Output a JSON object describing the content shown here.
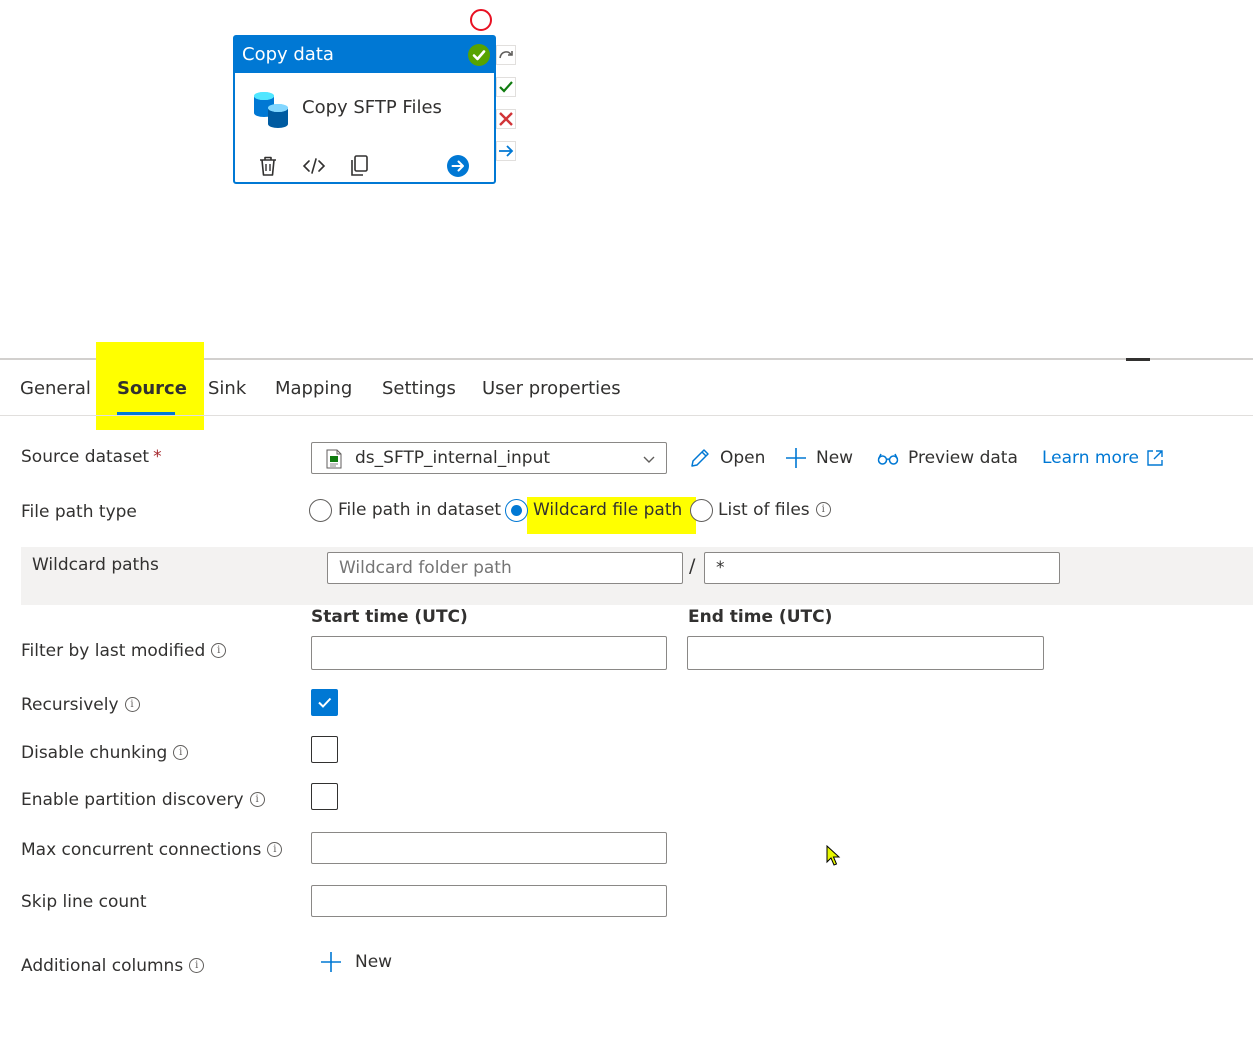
{
  "activity": {
    "type_label": "Copy data",
    "name": "Copy SFTP Files",
    "status_color": "#57a300",
    "header_color": "#0078d4",
    "tools": [
      "delete-icon",
      "code-icon",
      "copy-icon",
      "arrow-right-icon"
    ],
    "connectors": [
      "skip-icon",
      "success-icon",
      "failure-icon",
      "completion-icon"
    ]
  },
  "tabs": [
    {
      "label": "General"
    },
    {
      "label": "Source",
      "active": true
    },
    {
      "label": "Sink"
    },
    {
      "label": "Mapping"
    },
    {
      "label": "Settings"
    },
    {
      "label": "User properties"
    }
  ],
  "form": {
    "source_dataset": {
      "label": "Source dataset",
      "required_mark": "*",
      "value": "ds_SFTP_internal_input",
      "open_label": "Open",
      "new_label": "New",
      "preview_label": "Preview data",
      "learn_more_label": "Learn more"
    },
    "file_path_type": {
      "label": "File path type",
      "options": [
        {
          "label": "File path in dataset",
          "selected": false
        },
        {
          "label": "Wildcard file path",
          "selected": true
        },
        {
          "label": "List of files",
          "selected": false
        }
      ]
    },
    "wildcard_paths": {
      "label": "Wildcard paths",
      "folder_placeholder": "Wildcard folder path",
      "separator": "/",
      "file_value": "*"
    },
    "filter_last_modified": {
      "label": "Filter by last modified",
      "start_label": "Start time (UTC)",
      "end_label": "End time (UTC)",
      "start_value": "",
      "end_value": ""
    },
    "recursively": {
      "label": "Recursively",
      "checked": true
    },
    "disable_chunking": {
      "label": "Disable chunking",
      "checked": false
    },
    "enable_partition_discovery": {
      "label": "Enable partition discovery",
      "checked": false
    },
    "max_concurrent_connections": {
      "label": "Max concurrent connections",
      "value": ""
    },
    "skip_line_count": {
      "label": "Skip line count",
      "value": ""
    },
    "additional_columns": {
      "label": "Additional columns",
      "new_label": "New"
    }
  },
  "info_glyph": "i",
  "colors": {
    "accent": "#0078d4",
    "highlight": "#ffff00",
    "error": "#e81123",
    "required": "#a4262c"
  }
}
